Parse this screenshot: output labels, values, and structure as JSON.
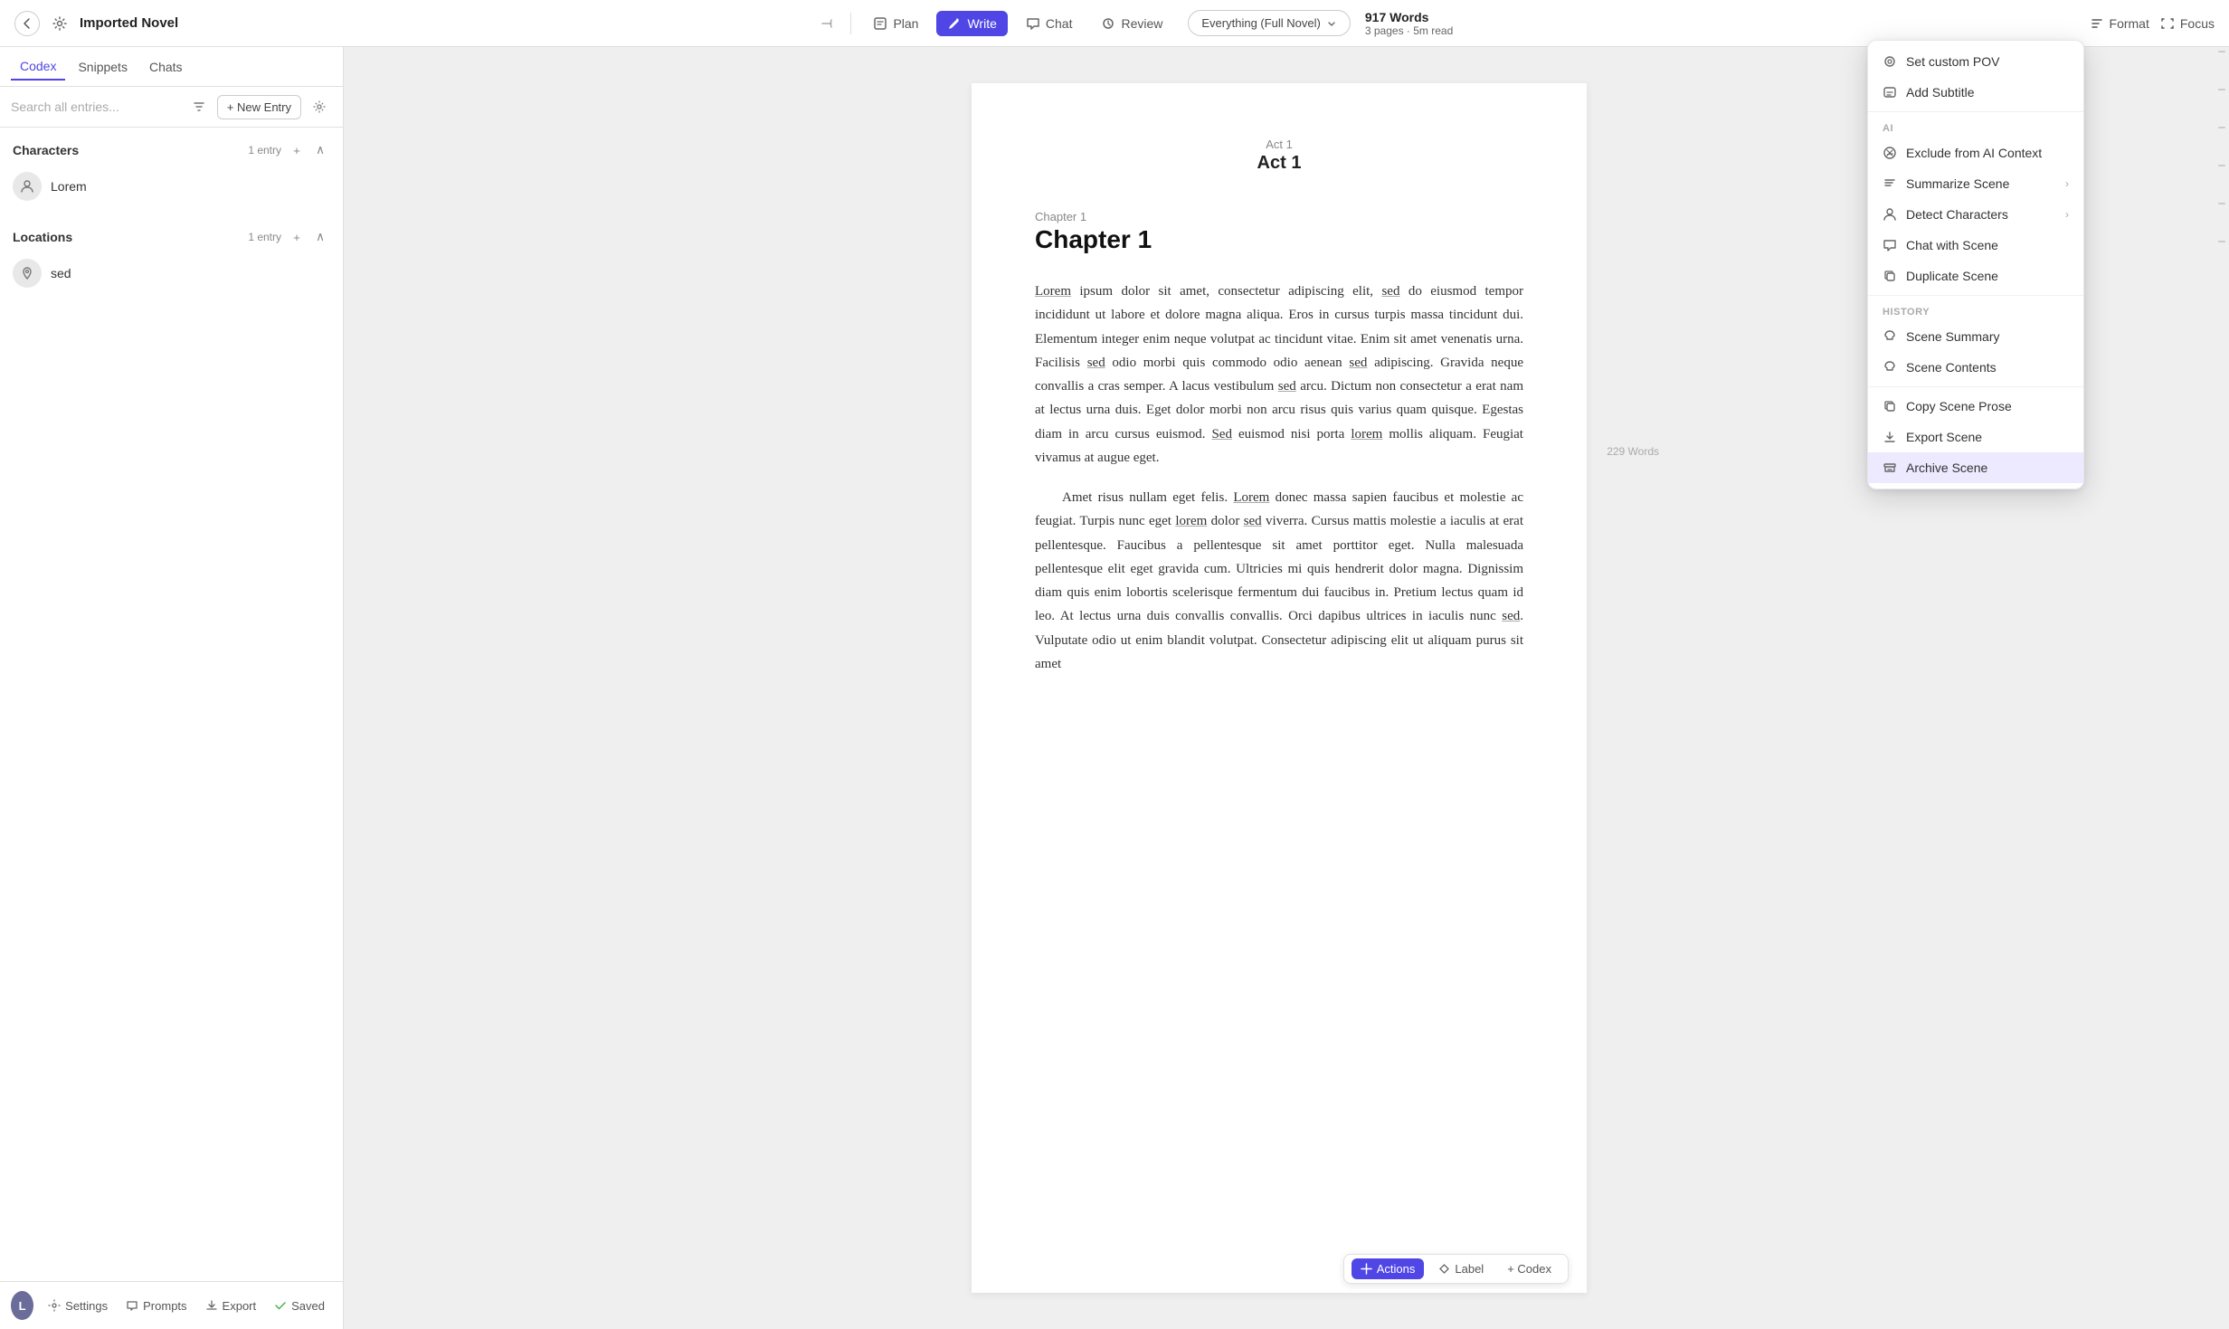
{
  "app": {
    "back_label": "←",
    "settings_label": "⚙",
    "title": "Imported Novel",
    "pin_label": "⊣"
  },
  "nav_tabs": [
    {
      "id": "plan",
      "label": "Plan",
      "icon": "plan",
      "active": false
    },
    {
      "id": "write",
      "label": "Write",
      "icon": "write",
      "active": true
    },
    {
      "id": "chat",
      "label": "Chat",
      "icon": "chat",
      "active": false
    },
    {
      "id": "review",
      "label": "Review",
      "icon": "review",
      "active": false
    }
  ],
  "scope_btn": "Everything (Full Novel)",
  "word_count": {
    "words": "917 Words",
    "meta": "3 pages · 5m read"
  },
  "nav_right": {
    "format": "Format",
    "focus": "Focus"
  },
  "sidebar": {
    "tabs": [
      {
        "id": "codex",
        "label": "Codex",
        "active": true
      },
      {
        "id": "snippets",
        "label": "Snippets",
        "active": false
      },
      {
        "id": "chats",
        "label": "Chats",
        "active": false
      }
    ],
    "search_placeholder": "Search all entries...",
    "new_entry_label": "+ New Entry",
    "sections": [
      {
        "id": "characters",
        "title": "Characters",
        "count": "1 entry",
        "entries": [
          {
            "id": "lorem",
            "name": "Lorem",
            "icon": "👤"
          }
        ]
      },
      {
        "id": "locations",
        "title": "Locations",
        "count": "1 entry",
        "entries": [
          {
            "id": "sed",
            "name": "sed",
            "icon": "📍"
          }
        ]
      }
    ],
    "footer": {
      "avatar_initials": "L",
      "settings": "Settings",
      "prompts": "Prompts",
      "export": "Export",
      "saved": "Saved"
    }
  },
  "editor": {
    "scene_label": "Act 1",
    "scene_title": "Act 1",
    "chapter_label": "Chapter 1",
    "chapter_title": "Chapter 1",
    "paragraphs": [
      "Lorem ipsum dolor sit amet, consectetur adipiscing elit, sed do eiusmod tempor incididunt ut labore et dolore magna aliqua. Eros in cursus turpis massa tincidunt dui. Elementum integer enim neque volutpat ac tincidunt vitae. Enim sit amet venenatis urna. Facilisis sed odio morbi quis commodo odio aenean sed adipiscing. Gravida neque convallis a cras semper. A lacus vestibulum sed arcu. Dictum non consectetur a erat nam at lectus urna duis. Eget dolor morbi non arcu risus quis varius quam quisque. Egestas diam in arcu cursus euismod. Sed euismod nisi porta lorem mollis aliquam. Feugiat vivamus at augue eget.",
      "Amet risus nullam eget felis. Lorem donec massa sapien faucibus et molestie ac feugiat. Turpis nunc eget lorem dolor sed viverra. Cursus mattis molestie a iaculis at erat pellentesque. Faucibus a pellentesque sit amet porttitor eget. Nulla malesuada pellentesque elit eget gravida cum. Ultricies mi quis hendrerit dolor magna. Dignissim diam quis enim lobortis scelerisque fermentum dui faucibus in. Pretium lectus quam id leo. At lectus urna duis convallis convallis. Orci dapibus ultrices in iaculis nunc sed. Vulputate odio ut enim blandit volutpat. Consectetur adipiscing elit ut aliquam purus sit amet"
    ],
    "word_count_badge": "229 Words"
  },
  "context_menu": {
    "visible": true,
    "sections": [
      {
        "items": [
          {
            "id": "set-custom-pov",
            "label": "Set custom POV",
            "icon": "pov",
            "has_arrow": false
          },
          {
            "id": "add-subtitle",
            "label": "Add Subtitle",
            "icon": "subtitle",
            "has_arrow": false
          }
        ]
      },
      {
        "section_label": "AI",
        "items": [
          {
            "id": "exclude-ai",
            "label": "Exclude from AI Context",
            "icon": "exclude",
            "has_arrow": false
          },
          {
            "id": "summarize-scene",
            "label": "Summarize Scene",
            "icon": "summarize",
            "has_arrow": true
          },
          {
            "id": "detect-characters",
            "label": "Detect Characters",
            "icon": "detect",
            "has_arrow": true
          },
          {
            "id": "chat-with-scene",
            "label": "Chat with Scene",
            "icon": "chat",
            "has_arrow": false
          },
          {
            "id": "duplicate-scene",
            "label": "Duplicate Scene",
            "icon": "duplicate",
            "has_arrow": false
          }
        ]
      },
      {
        "section_label": "HISTORY",
        "items": [
          {
            "id": "scene-summary",
            "label": "Scene Summary",
            "icon": "history",
            "has_arrow": false
          },
          {
            "id": "scene-contents",
            "label": "Scene Contents",
            "icon": "history",
            "has_arrow": false
          }
        ]
      },
      {
        "items": [
          {
            "id": "copy-scene-prose",
            "label": "Copy Scene Prose",
            "icon": "copy",
            "has_arrow": false
          },
          {
            "id": "export-scene",
            "label": "Export Scene",
            "icon": "export",
            "has_arrow": false
          },
          {
            "id": "archive-scene",
            "label": "Archive Scene",
            "icon": "archive",
            "has_arrow": false,
            "highlighted": true
          }
        ]
      }
    ]
  },
  "scene_actions": {
    "actions_label": "Actions",
    "label_label": "Label",
    "codex_label": "+ Codex"
  }
}
